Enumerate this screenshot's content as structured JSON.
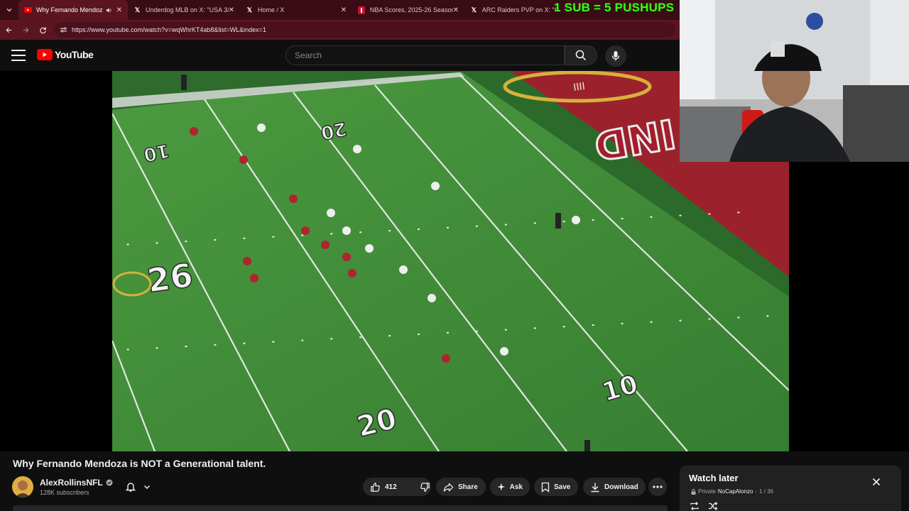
{
  "browser": {
    "tabs": [
      {
        "title": "Why Fernando Mendoza is",
        "active": true,
        "icon": "youtube-icon"
      },
      {
        "title": "Underdog MLB on X: \"USA 3/7",
        "active": false,
        "icon": "x-logo-icon"
      },
      {
        "title": "Home / X",
        "active": false,
        "icon": "x-logo-icon"
      },
      {
        "title": "NBA Scores, 2025-26 Season -",
        "active": false,
        "icon": "nba-icon"
      },
      {
        "title": "ARC Raiders PVP on X: \"Cinc",
        "active": false,
        "icon": "x-logo-icon"
      }
    ],
    "close_glyph": "✕",
    "url": "https://www.youtube.com/watch?v=wqWhrKT4ab8&list=WL&index=1"
  },
  "stream_overlay": {
    "text": "1 SUB = 5 PUSHUPS",
    "color": "#39ff14"
  },
  "youtube": {
    "logo_text": "YouTube",
    "search_placeholder": "Search"
  },
  "video": {
    "field_numbers": [
      "10",
      "20",
      "26",
      "20",
      "10",
      "10"
    ],
    "scene": "football-game-aerial-view"
  },
  "video_info": {
    "title": "Why Fernando Mendoza is NOT a Generational talent.",
    "channel": "AlexRollinsNFL",
    "subscribers": "128K subscribers",
    "likes": "412",
    "share_label": "Share",
    "ask_label": "Ask",
    "save_label": "Save",
    "download_label": "Download"
  },
  "watch_later": {
    "title": "Watch later",
    "privacy": "Private",
    "owner": "NoCapAlonzo",
    "position": "1 / 36"
  },
  "colors": {
    "tab_strip": "#3a0c15",
    "address_bar": "#5b1521",
    "youtube_red": "#ff0000",
    "page_bg": "#0f0f0f",
    "turf": "#3f8a37",
    "endzone": "#a51c2c"
  }
}
